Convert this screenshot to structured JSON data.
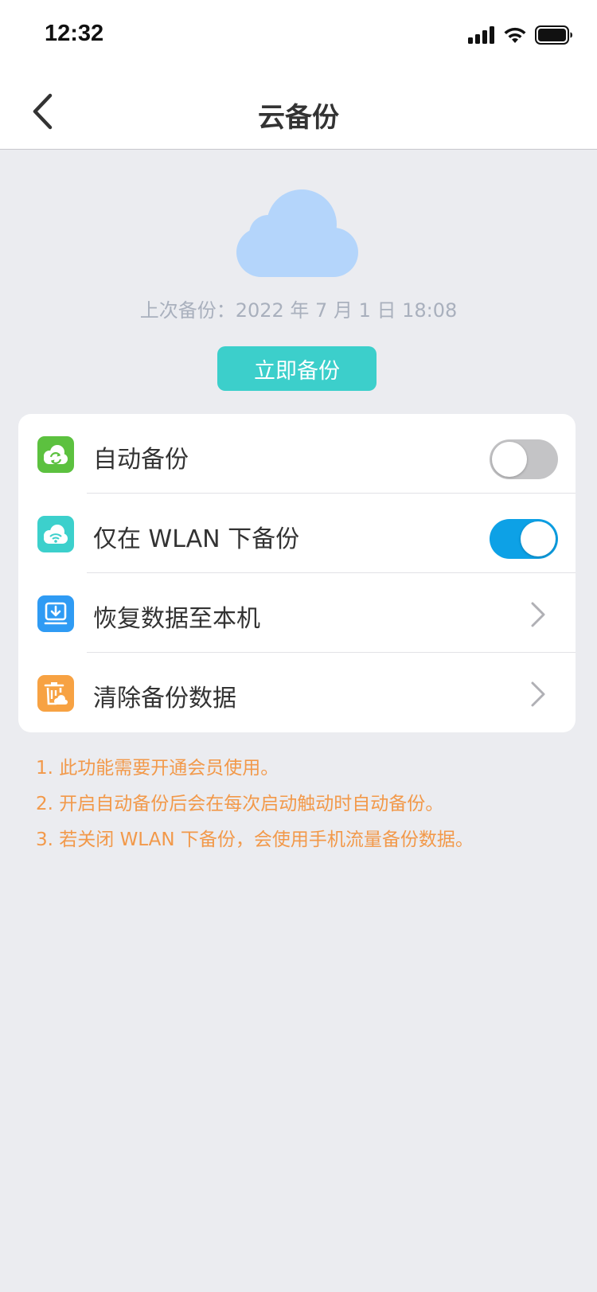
{
  "status_bar": {
    "time": "12:32"
  },
  "nav": {
    "title": "云备份"
  },
  "hero": {
    "last_backup": "上次备份：2022 年 7 月 1 日 18:08",
    "backup_now_label": "立即备份"
  },
  "settings": [
    {
      "label": "自动备份",
      "icon": "cloud-sync-icon",
      "icon_color": "#5cc13f",
      "control": "toggle",
      "on": false
    },
    {
      "label": "仅在 WLAN 下备份",
      "icon": "cloud-wifi-icon",
      "icon_color": "#3cd0cc",
      "control": "toggle",
      "on": true
    },
    {
      "label": "恢复数据至本机",
      "icon": "download-icon",
      "icon_color": "#2f9bf4",
      "control": "chevron"
    },
    {
      "label": "清除备份数据",
      "icon": "trash-cloud-icon",
      "icon_color": "#f7a243",
      "control": "chevron"
    }
  ],
  "notes": [
    "1. 此功能需要开通会员使用。",
    "2. 开启自动备份后会在每次启动触动时自动备份。",
    "3. 若关闭 WLAN 下备份，会使用手机流量备份数据。"
  ],
  "colors": {
    "accent_teal": "#3ccfcb",
    "toggle_on": "#0da1e6",
    "note_orange": "#f2994a",
    "cloud_blue": "#b4d5fb"
  }
}
